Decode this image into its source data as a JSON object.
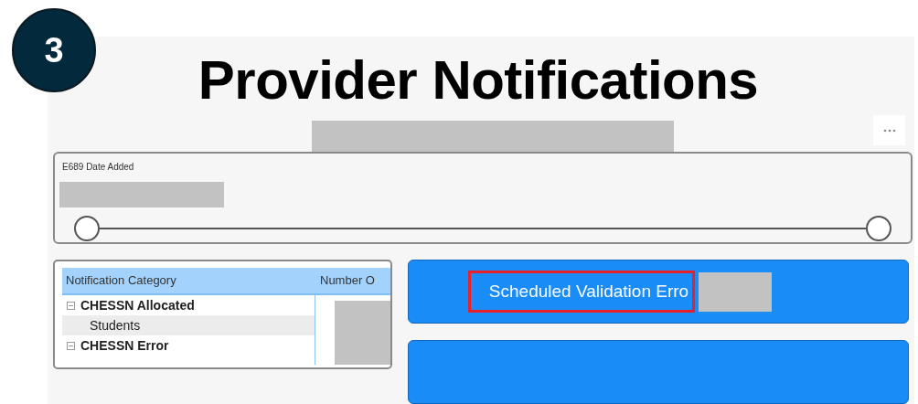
{
  "step_badge": "3",
  "title": "Provider Notifications",
  "date_slicer": {
    "label": "E689 Date Added",
    "thumbs": [
      {
        "level": 0
      },
      {
        "level": 1
      }
    ]
  },
  "table": {
    "columns": [
      "Notification Category",
      "Number O"
    ],
    "rows": [
      {
        "label": "CHESSN Allocated",
        "expanded": true,
        "children": [
          {
            "label": "Students"
          }
        ]
      },
      {
        "label": "CHESSN Error",
        "expanded": true
      }
    ]
  },
  "buttons": [
    {
      "label": "Scheduled Validation Erro",
      "highlighted": true
    }
  ]
}
